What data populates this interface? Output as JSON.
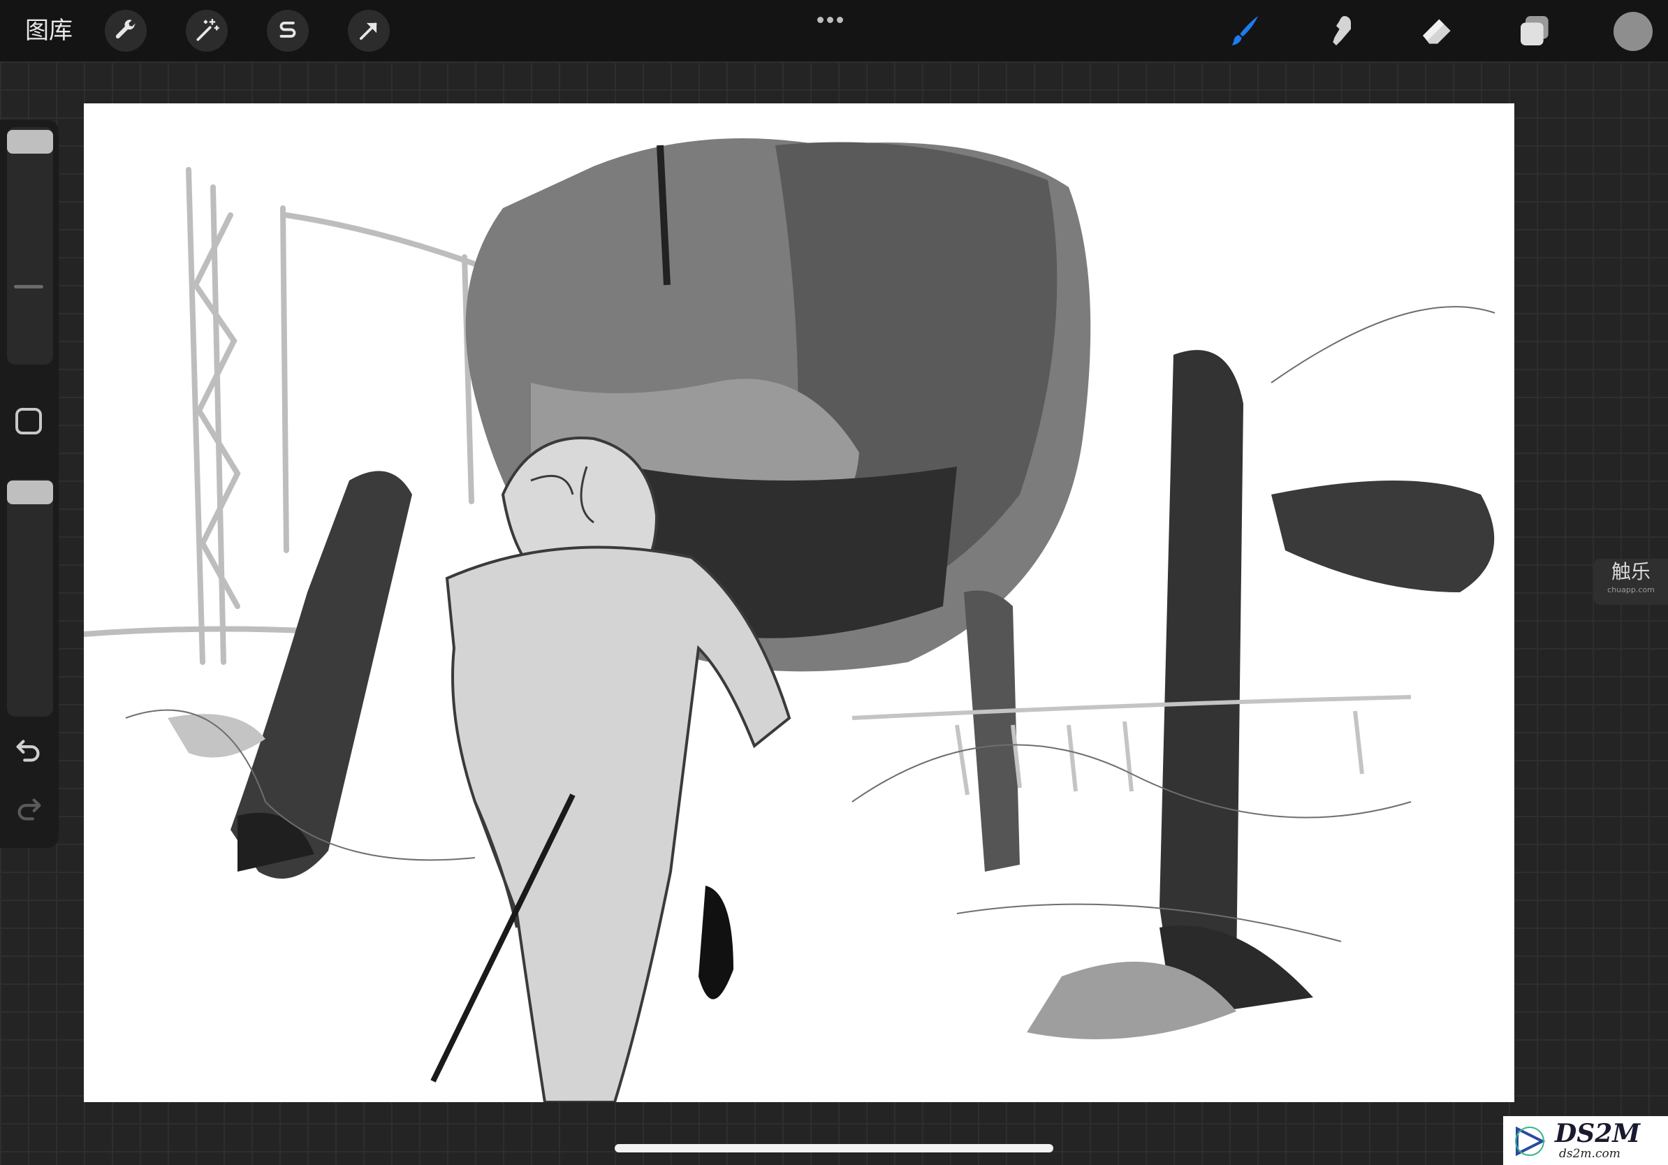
{
  "toolbar": {
    "gallery_label": "图库",
    "left_tools": [
      "wrench-icon",
      "magic-wand-icon",
      "selection-s-icon",
      "transform-arrow-icon"
    ],
    "right_tools": [
      "brush-icon",
      "smudge-icon",
      "eraser-icon",
      "layers-icon"
    ],
    "active_tool": "brush",
    "active_color": "#1e7bf0",
    "current_color": "#8e8e8e"
  },
  "sidebar": {
    "brush_size_level": 0.06,
    "opacity_level": 0.02,
    "controls": [
      "brush-size-slider",
      "modify-button",
      "opacity-slider",
      "undo-button",
      "redo-button"
    ]
  },
  "canvas": {
    "content": "grayscale sketch: girl running, giant robotic walker behind, industrial towers"
  },
  "watermarks": {
    "chuapp_main": "触乐",
    "chuapp_sub": "chuapp.com",
    "ds2m_main": "DS2M",
    "ds2m_sub": "ds2m.com"
  }
}
